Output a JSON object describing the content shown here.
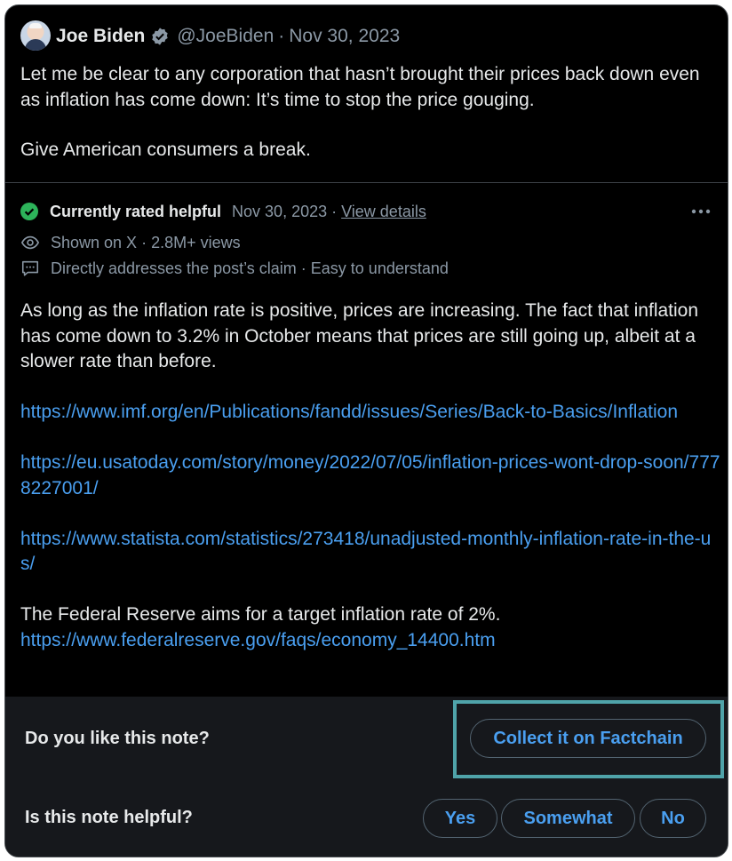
{
  "tweet": {
    "author_name": "Joe Biden",
    "handle": "@JoeBiden",
    "separator": "·",
    "date": "Nov 30, 2023",
    "paragraphs": [
      "Let me be clear to any corporation that hasn’t brought their prices back down even as inflation has come down: It’s time to stop the price gouging.",
      "Give American consumers a break."
    ]
  },
  "note": {
    "status": "Currently rated helpful",
    "date": "Nov 30, 2023",
    "separator": "·",
    "view_details": "View details",
    "shown_on": "Shown on X · 2.8M+ views",
    "reasons": "Directly addresses the post’s claim · Easy to understand",
    "body": {
      "intro": "As long as the inflation rate is positive, prices are increasing. The fact that inflation has come down to 3.2% in October means that prices are still going up, albeit at a slower rate than before.",
      "link1": "https://www.imf.org/en/Publications/fandd/issues/Series/Back-to-Basics/Inflation",
      "link2": "https://eu.usatoday.com/story/money/2022/07/05/inflation-prices-wont-drop-soon/7778227001/",
      "link3": "https://www.statista.com/statistics/273418/unadjusted-monthly-inflation-rate-in-the-us/",
      "fed_text": "The Federal Reserve aims for a target inflation rate of 2%.",
      "link4": "https://www.federalreserve.gov/faqs/economy_14400.htm"
    }
  },
  "feedback": {
    "like_question": "Do you like this note?",
    "collect_label": "Collect it on Factchain",
    "helpful_question": "Is this note helpful?",
    "options": [
      "Yes",
      "Somewhat",
      "No"
    ]
  },
  "colors": {
    "background": "#000000",
    "link": "#4a9ff0",
    "muted": "#8b98a5",
    "helpful_green": "#2db35a",
    "highlight": "#4fa3a9"
  },
  "icons": [
    "verified-badge-icon",
    "check-circle-icon",
    "more-icon",
    "eye-icon",
    "comment-icon"
  ]
}
